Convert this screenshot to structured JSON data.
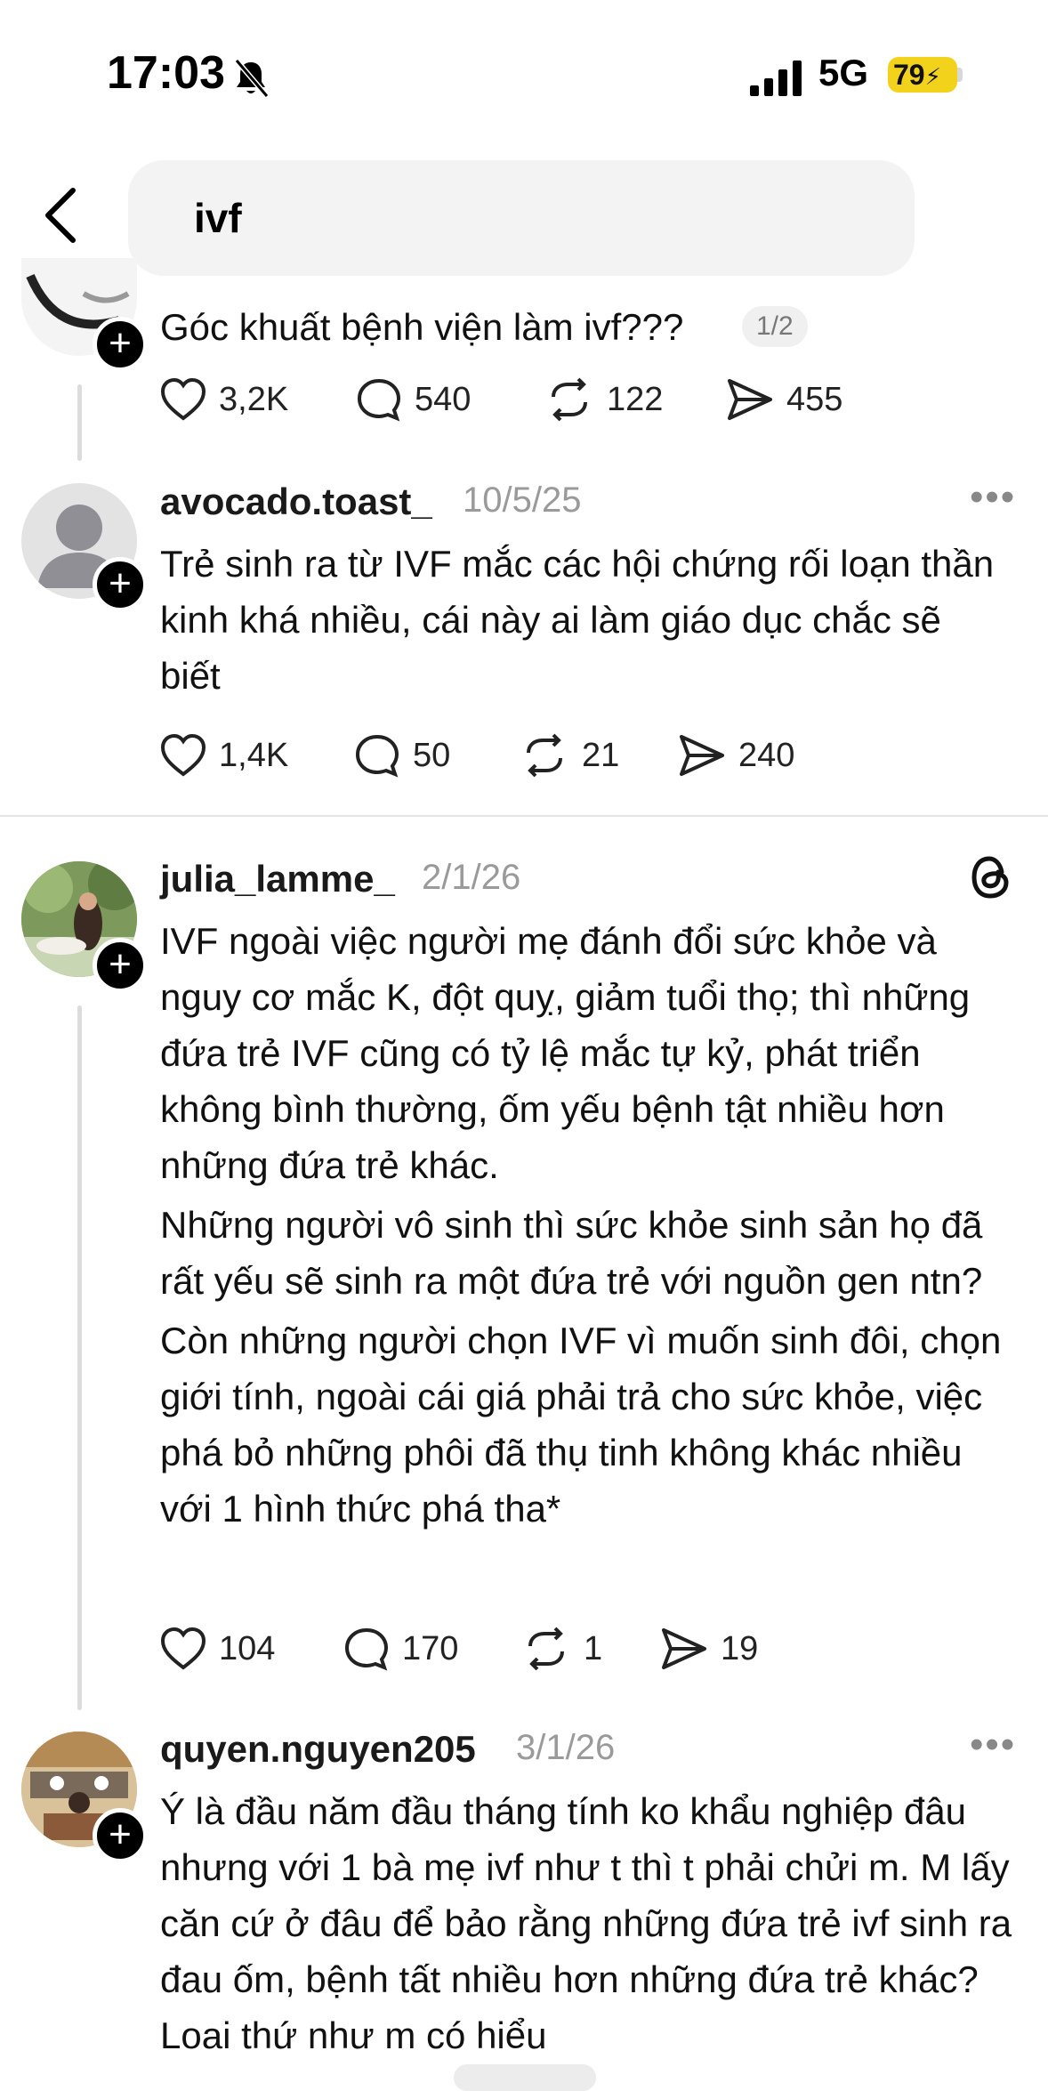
{
  "status_bar": {
    "time": "17:03",
    "network": "5G",
    "battery": "79"
  },
  "search": {
    "query": "ivf"
  },
  "posts": [
    {
      "text": "Góc khuất bệnh viện làm ivf???",
      "page_indicator": "1/2",
      "likes": "3,2K",
      "replies": "540",
      "reposts": "122",
      "shares": "455"
    },
    {
      "username": "avocado.toast_",
      "date": "10/5/25",
      "text": "Trẻ sinh ra từ IVF mắc các hội chứng rối loạn thần kinh khá nhiều, cái này ai làm giáo dục chắc sẽ biết",
      "likes": "1,4K",
      "replies": "50",
      "reposts": "21",
      "shares": "240"
    },
    {
      "username": "julia_lamme_",
      "date": "2/1/26",
      "paragraphs": [
        "IVF ngoài việc người mẹ đánh đổi sức khỏe và nguy cơ mắc K, đột quỵ, giảm tuổi thọ; thì những đứa trẻ IVF cũng có tỷ lệ mắc tự kỷ, phát triển không bình thường, ốm yếu bệnh tật nhiều hơn những đứa trẻ khác.",
        "Những người vô sinh thì sức khỏe sinh sản họ đã rất yếu sẽ sinh ra một đứa trẻ với nguồn gen ntn?",
        "Còn những người chọn IVF vì muốn sinh đôi, chọn giới tính, ngoài cái giá phải trả cho sức khỏe, việc phá bỏ những phôi đã thụ tinh không khác nhiều với 1 hình thức phá tha*"
      ],
      "likes": "104",
      "replies": "170",
      "reposts": "1",
      "shares": "19"
    },
    {
      "username": "quyen.nguyen205",
      "date": "3/1/26",
      "text": "Ý là đầu năm đầu tháng tính ko khẩu nghiệp đâu nhưng với 1 bà mẹ ivf như t thì t phải chửi m. M lấy căn cứ ở đâu để bảo rằng những đứa trẻ ivf sinh ra đau ốm, bệnh tất nhiều hơn những đứa trẻ khác? Loại thứ như m có hiểu"
    }
  ],
  "colors": {
    "accent_battery": "#f2d21a",
    "divider": "#e6e6e6",
    "muted_text": "#9a9a9a"
  }
}
